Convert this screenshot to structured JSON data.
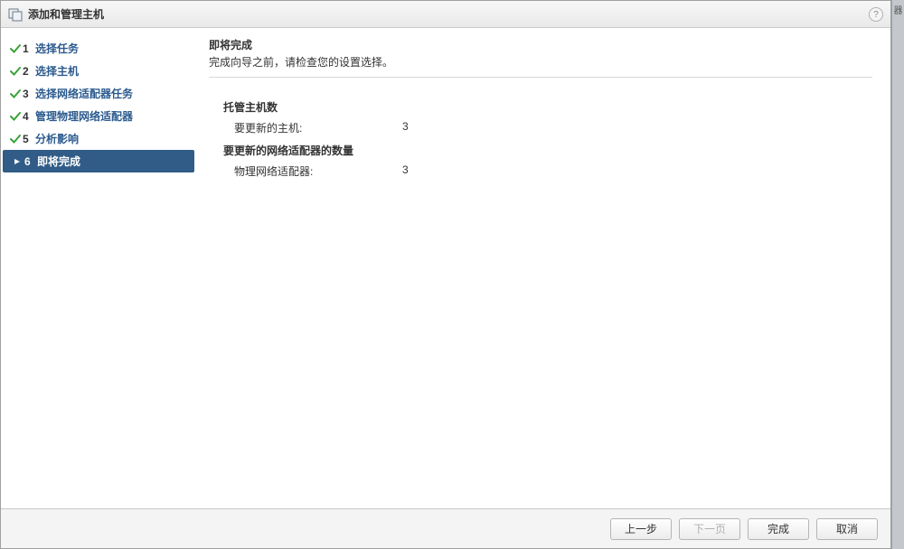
{
  "title": "添加和管理主机",
  "nav": [
    {
      "num": "1",
      "label": "选择任务",
      "done": true
    },
    {
      "num": "2",
      "label": "选择主机",
      "done": true
    },
    {
      "num": "3",
      "label": "选择网络适配器任务",
      "done": true
    },
    {
      "num": "4",
      "label": "管理物理网络适配器",
      "done": true
    },
    {
      "num": "5",
      "label": "分析影响",
      "done": true
    },
    {
      "num": "6",
      "label": "即将完成",
      "active": true
    }
  ],
  "content": {
    "heading": "即将完成",
    "sub": "完成向导之前，请检查您的设置选择。",
    "sections": [
      {
        "title": "托管主机数",
        "rows": [
          {
            "key": "要更新的主机:",
            "val": "3"
          }
        ]
      },
      {
        "title": "要更新的网络适配器的数量",
        "rows": [
          {
            "key": "物理网络适配器:",
            "val": "3"
          }
        ]
      }
    ]
  },
  "buttons": {
    "back": "上一步",
    "next": "下一页",
    "finish": "完成",
    "cancel": "取消"
  },
  "help_glyph": "?",
  "right_glyph": "器"
}
